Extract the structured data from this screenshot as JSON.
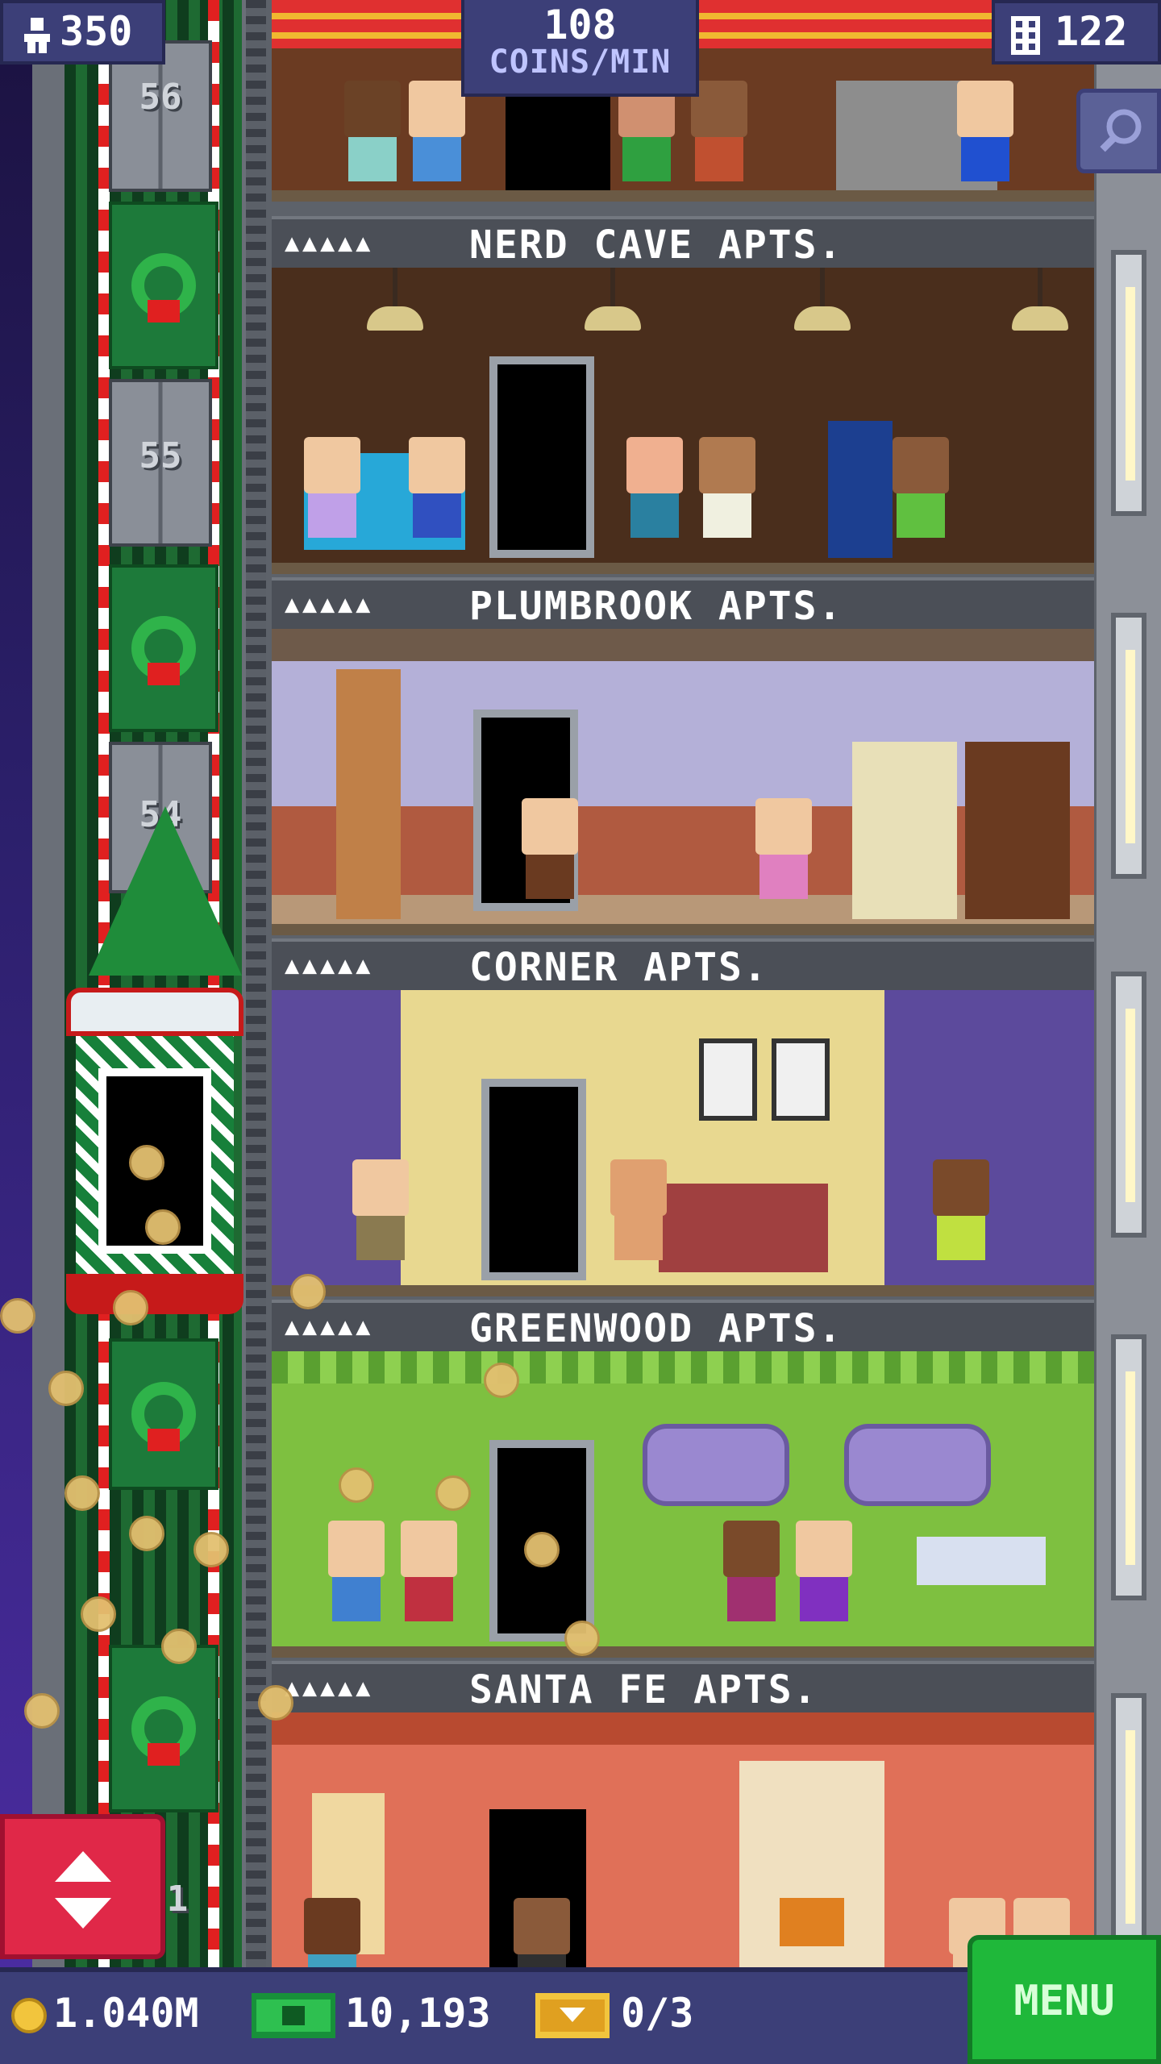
{
  "hud": {
    "population": "350",
    "coins_rate_value": "108",
    "coins_rate_unit": "COINS/MIN",
    "floor_count": "122",
    "coins_total": "1.040M",
    "bux_total": "10,193",
    "vip_count": "0/3",
    "menu_label": "MENU"
  },
  "elevator": {
    "floor_numbers": [
      "56",
      "55",
      "54"
    ],
    "bottom_floor_number": "1"
  },
  "floors": [
    {
      "name": "NERD CAVE APTS.",
      "pips": "▲▲▲▲▲"
    },
    {
      "name": "PLUMBROOK APTS.",
      "pips": "▲▲▲▲▲"
    },
    {
      "name": "CORNER APTS.",
      "pips": "▲▲▲▲▲"
    },
    {
      "name": "GREENWOOD APTS.",
      "pips": "▲▲▲▲▲"
    },
    {
      "name": "SANTA FE APTS.",
      "pips": "▲▲▲▲▲"
    }
  ],
  "icons": {
    "population": "person-icon",
    "floors": "building-icon",
    "search": "magnifier-icon",
    "elevator_control": "up-down-arrows-icon",
    "coins": "coin-icon",
    "bux": "banknote-icon",
    "vip": "ticket-icon"
  },
  "colors": {
    "hud_bg": "#3c3f78",
    "menu_green": "#1fb83a",
    "elevator_button_red": "#e02848",
    "coin_gold": "#f2c53d"
  }
}
